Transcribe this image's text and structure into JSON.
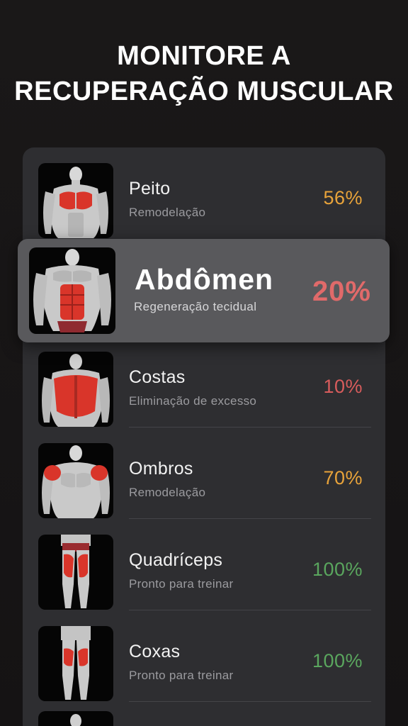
{
  "headline": {
    "line1": "MONITORE A",
    "line2": "RECUPERAÇÃO MUSCULAR"
  },
  "muscles": [
    {
      "name": "Peito",
      "status": "Remodelação",
      "percent": "56%",
      "color": "#e8a33a",
      "icon": "chest-muscle-icon"
    },
    {
      "name": "Abdômen",
      "status": "Regeneração tecidual",
      "percent": "20%",
      "color": "#e06a6a",
      "icon": "abs-muscle-icon"
    },
    {
      "name": "Costas",
      "status": "Eliminação de excesso",
      "percent": "10%",
      "color": "#d85c5c",
      "icon": "back-muscle-icon"
    },
    {
      "name": "Ombros",
      "status": "Remodelação",
      "percent": "70%",
      "color": "#e8a33a",
      "icon": "shoulder-muscle-icon"
    },
    {
      "name": "Quadríceps",
      "status": "Pronto para treinar",
      "percent": "100%",
      "color": "#5aa65e",
      "icon": "quadriceps-muscle-icon"
    },
    {
      "name": "Coxas",
      "status": "Pronto para treinar",
      "percent": "100%",
      "color": "#5aa65e",
      "icon": "hamstring-muscle-icon"
    }
  ],
  "colors": {
    "background": "#151314",
    "card": "#2e2e31",
    "highlight": "#59595c",
    "muscle_red": "#d9352a"
  }
}
